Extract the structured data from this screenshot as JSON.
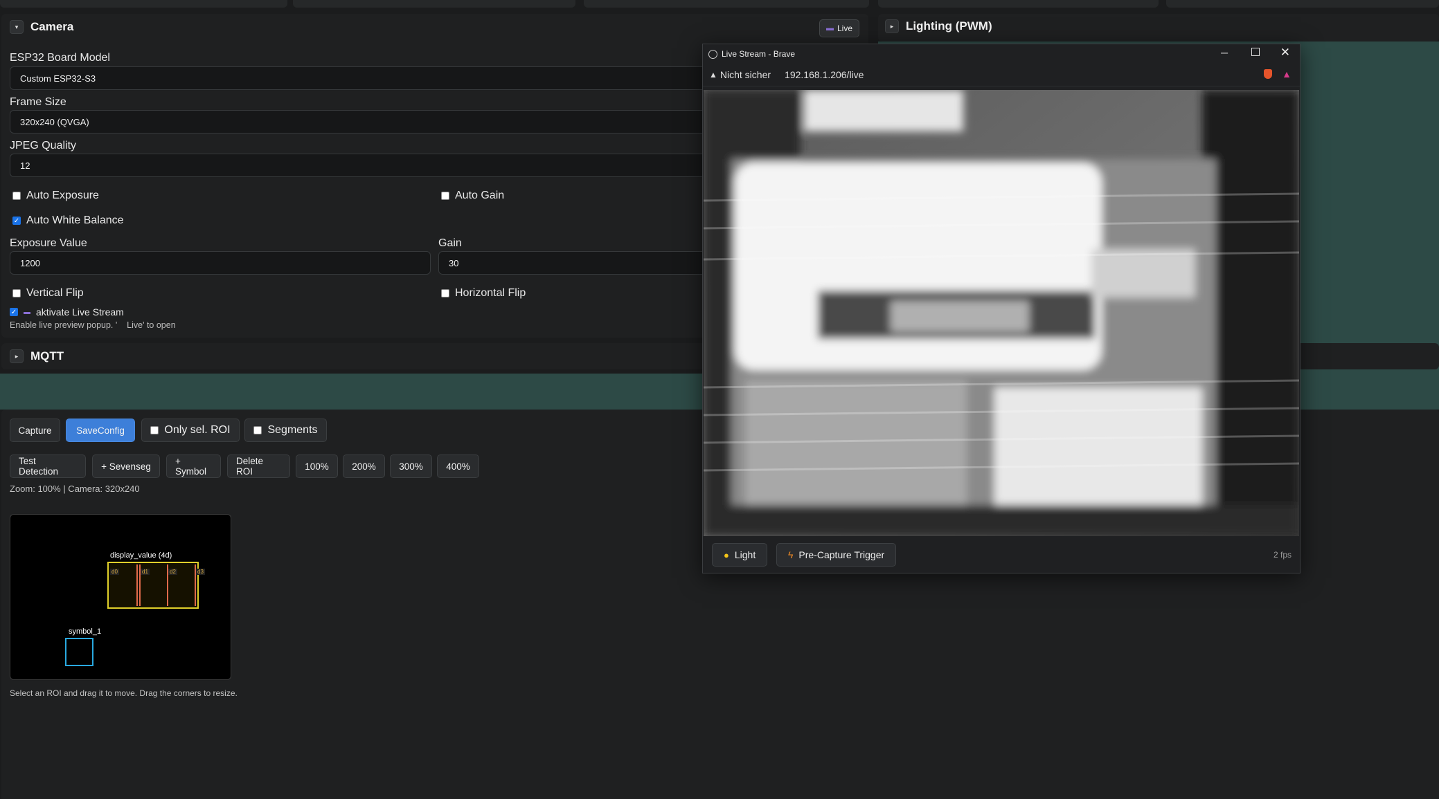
{
  "camera": {
    "title": "Camera",
    "live_button": "Live",
    "board_model_label": "ESP32 Board Model",
    "board_model_value": "Custom ESP32-S3",
    "frame_size_label": "Frame Size",
    "frame_size_value": "320x240 (QVGA)",
    "jpeg_quality_label": "JPEG Quality",
    "jpeg_quality_value": "12",
    "auto_exposure_label": "Auto Exposure",
    "auto_gain_label": "Auto Gain",
    "auto_white_balance_label": "Auto White Balance",
    "exposure_value_label": "Exposure Value",
    "exposure_value": "1200",
    "gain_label": "Gain",
    "gain_value": "30",
    "vertical_flip_label": "Vertical Flip",
    "horizontal_flip_label": "Horizontal Flip",
    "live_stream_label": "aktivate Live Stream",
    "live_stream_hint": "Enable live preview popup. '    Live' to open",
    "checks": {
      "auto_exposure": false,
      "auto_gain": false,
      "auto_white_balance": true,
      "vertical_flip": false,
      "horizontal_flip": false,
      "live_stream": true
    }
  },
  "lighting": {
    "title": "Lighting (PWM)"
  },
  "mqtt": {
    "title": "MQTT"
  },
  "toolbar": {
    "capture": "Capture",
    "saveconfig": "SaveConfig",
    "only_sel_roi": "Only sel. ROI",
    "segments": "Segments",
    "test_detection": "Test Detection",
    "add_sevenseg": "+ Sevenseg",
    "add_symbol": "+ Symbol",
    "delete_roi": "Delete ROI",
    "zoom_100": "100%",
    "zoom_200": "200%",
    "zoom_300": "300%",
    "zoom_400": "400%",
    "zoom_status": "Zoom: 100% | Camera: 320x240"
  },
  "roi": {
    "display_label": "display_value (4d)",
    "digits": [
      "d0",
      "d1",
      "d2",
      "d3"
    ],
    "symbol_label": "symbol_1",
    "help_text": "Select an ROI and drag it to move. Drag the corners to resize."
  },
  "popup": {
    "window_title": "Live Stream - Brave",
    "security": "Nicht sicher",
    "url": "192.168.1.206/live",
    "light_button": "Light",
    "precapture_button": "Pre-Capture Trigger",
    "fps": "2 fps"
  },
  "colors": {
    "accent": "#3d7fd9",
    "teal": "#2d4a46",
    "roi_yellow": "#e0d02a",
    "roi_red": "#e06a4a",
    "roi_cyan": "#29a9e0"
  }
}
